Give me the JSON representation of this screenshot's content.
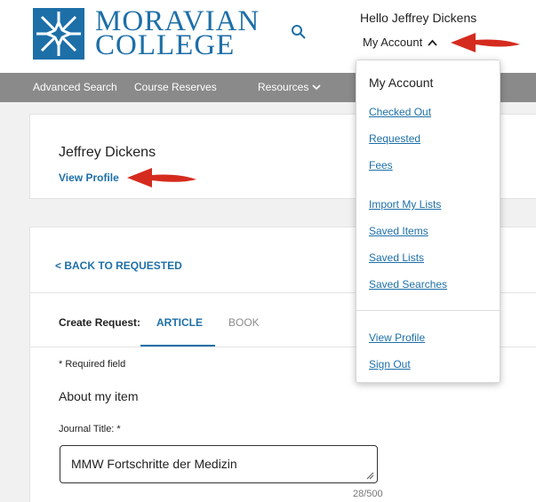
{
  "header": {
    "logo_line1": "MORAVIAN",
    "logo_line2": "COLLEGE",
    "greeting": "Hello Jeffrey Dickens",
    "account_label": "My Account"
  },
  "nav": {
    "items": [
      "Advanced Search",
      "Course Reserves",
      "Resources"
    ]
  },
  "profile": {
    "name": "Jeffrey Dickens",
    "view_profile": "View Profile"
  },
  "request": {
    "back_link": "< BACK TO REQUESTED",
    "create_label": "Create Request:",
    "tabs": [
      "ARTICLE",
      "BOOK"
    ],
    "active_tab": "ARTICLE",
    "required_note": "* Required field",
    "section_title": "About my item",
    "journal_label": "Journal Title: *",
    "journal_value": "MMW Fortschritte der Medizin",
    "char_count": "28/500"
  },
  "dropdown": {
    "title": "My Account",
    "links_group1": [
      "Checked Out",
      "Requested",
      "Fees"
    ],
    "links_group2": [
      "Import My Lists",
      "Saved Items",
      "Saved Lists",
      "Saved Searches"
    ],
    "links_group3": [
      "View Profile",
      "Sign Out"
    ]
  },
  "colors": {
    "brand": "#1d6fa8",
    "nav_bg": "#8a8a8a",
    "arrow": "#d52b1e"
  }
}
